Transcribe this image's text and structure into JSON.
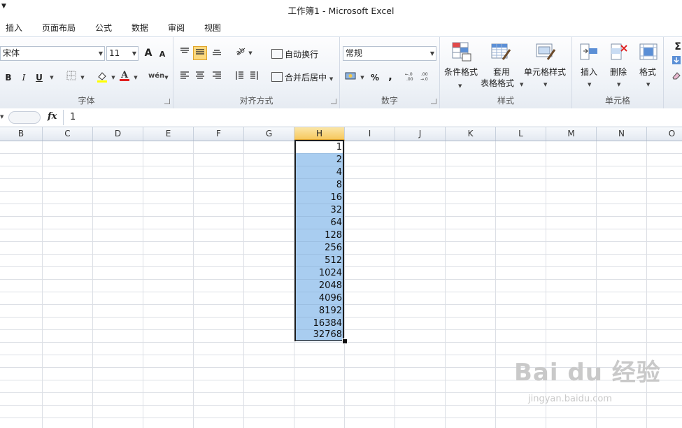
{
  "window": {
    "title": "工作簿1  -  Microsoft Excel"
  },
  "tabs": [
    "插入",
    "页面布局",
    "公式",
    "数据",
    "审阅",
    "视图"
  ],
  "ribbon": {
    "font": {
      "name": "宋体",
      "size": "11",
      "label": "字体",
      "bold": "B",
      "italic": "I",
      "underline": "U",
      "grow": "A",
      "shrink": "A",
      "phonetic": "wén"
    },
    "alignment": {
      "wrap": "自动换行",
      "merge": "合并后居中",
      "label": "对齐方式"
    },
    "number": {
      "format": "常规",
      "percent": "%",
      "comma": ",",
      "label": "数字"
    },
    "styles": {
      "conditional": "条件格式",
      "table1": "套用",
      "table2": "表格格式",
      "cell": "单元格样式",
      "label": "样式"
    },
    "cells": {
      "insert": "插入",
      "delete": "删除",
      "format": "格式",
      "label": "单元格"
    },
    "editing": {
      "sum": "Σ"
    }
  },
  "formula": {
    "fx": "fx",
    "value": "1"
  },
  "columns": [
    "B",
    "C",
    "D",
    "E",
    "F",
    "G",
    "H",
    "I",
    "J",
    "K",
    "L",
    "M",
    "N",
    "O"
  ],
  "selected_column": "H",
  "cells_h": [
    "1",
    "2",
    "4",
    "8",
    "16",
    "32",
    "64",
    "128",
    "256",
    "512",
    "1024",
    "2048",
    "4096",
    "8192",
    "16384",
    "32768"
  ],
  "watermark": {
    "brand": "Bai du 经验",
    "url": "jingyan.baidu.com"
  }
}
